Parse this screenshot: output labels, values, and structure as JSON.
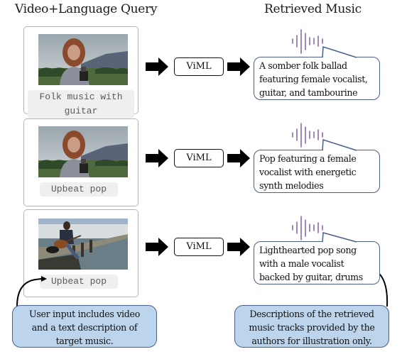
{
  "headers": {
    "left": "Video+Language Query",
    "right": "Retrieved Music"
  },
  "model_label": "ViML",
  "rows": [
    {
      "query_text": "Folk music with guitar",
      "video_scene": "woman-with-camera-mountains",
      "result_description": [
        "A somber folk ballad",
        "featuring female vocalist,",
        "guitar, and tambourine"
      ]
    },
    {
      "query_text": "Upbeat pop",
      "video_scene": "woman-with-camera-mountains",
      "result_description": [
        "Pop featuring a female",
        "vocalist with energetic",
        "synth melodies"
      ]
    },
    {
      "query_text": "Upbeat pop",
      "video_scene": "man-with-guitar-on-pier",
      "result_description": [
        "Lighthearted pop song",
        "with a male vocalist",
        "backed by guitar, drums"
      ]
    }
  ],
  "notes": {
    "left": [
      "User input includes video",
      "and a text description of",
      "target music."
    ],
    "right": [
      "Descriptions of the retrieved",
      "music tracks provided by the",
      "authors for illustration only."
    ]
  },
  "colors": {
    "waveform": "#8b6aa8",
    "bubble_border": "#4a5f8a",
    "note_fill": "#bdd5ec",
    "card_border": "#b5b5b5",
    "chip_fill": "#efefef"
  },
  "icons": {
    "arrow": "right-block-arrow",
    "waveform": "audio-waveform"
  }
}
